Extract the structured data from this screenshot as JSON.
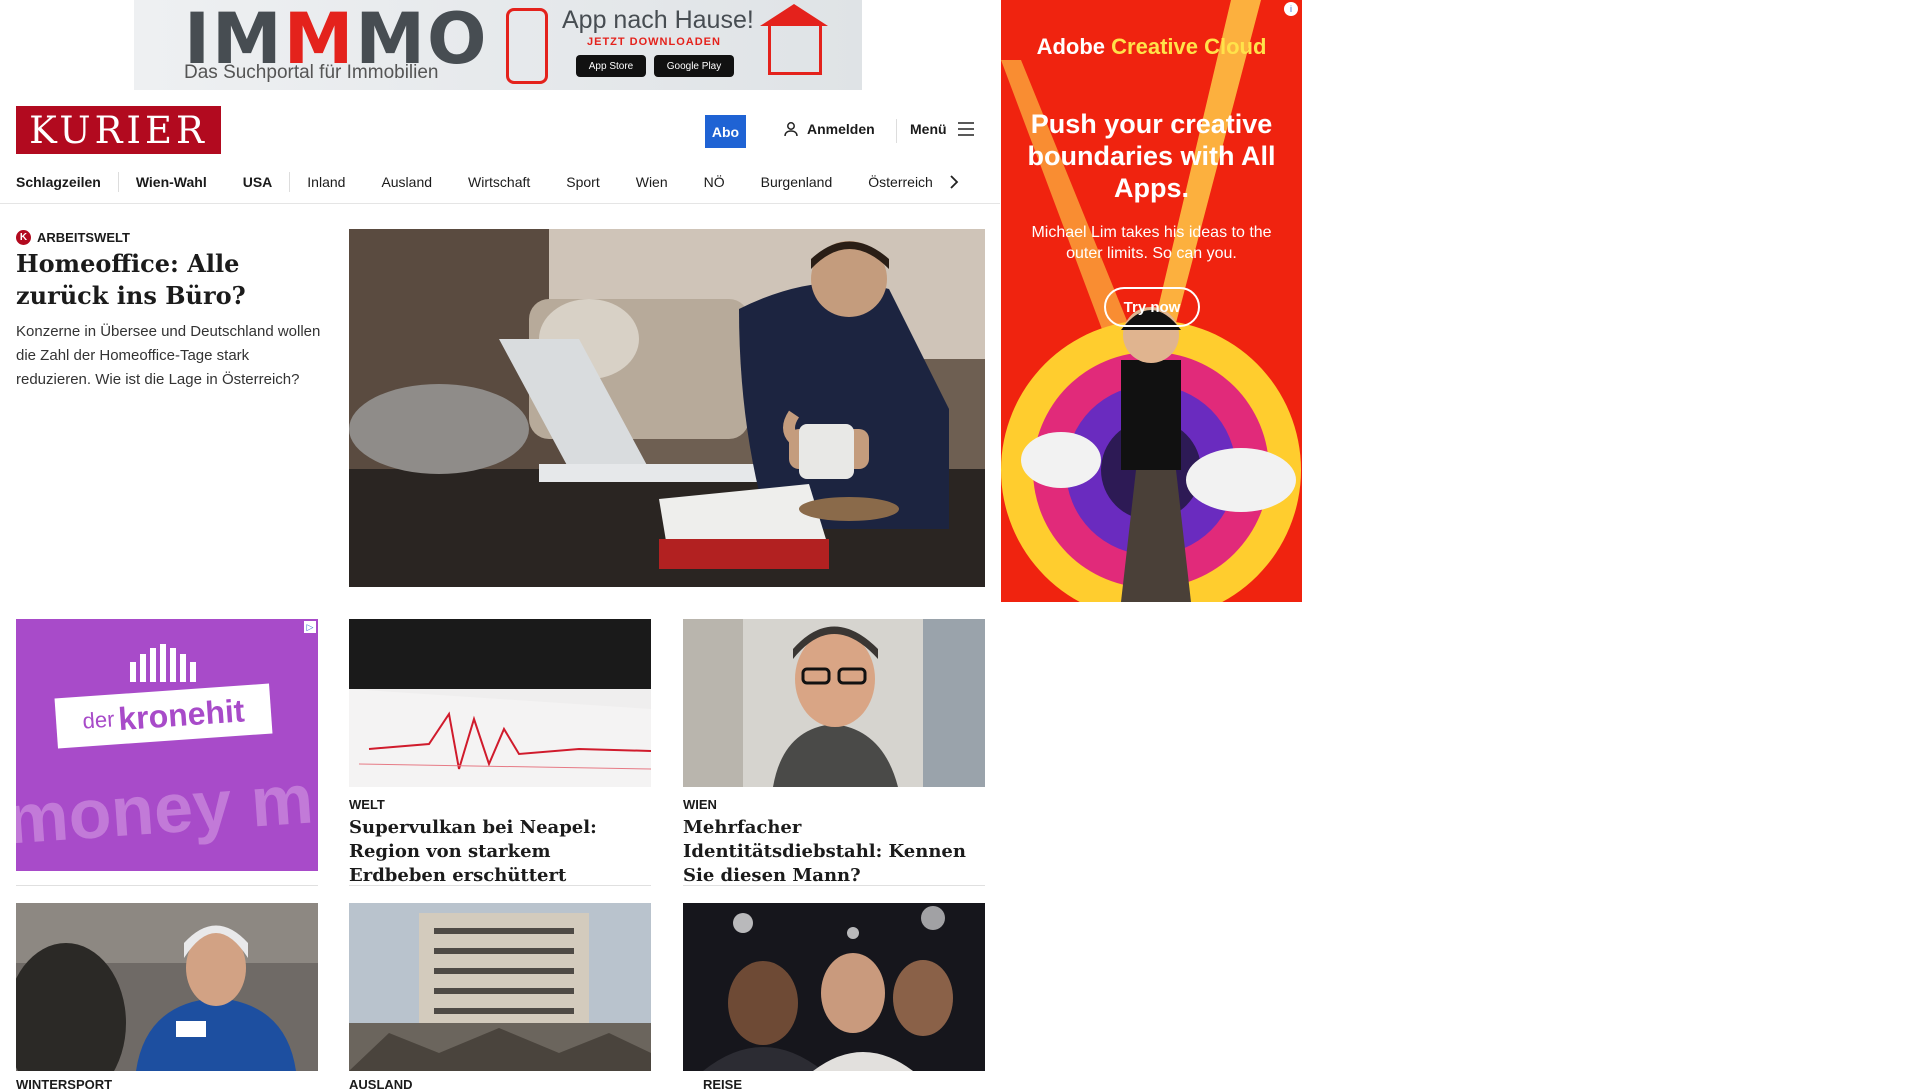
{
  "top_ad": {
    "logo_part1": "IM",
    "logo_part2": "M",
    "logo_part3": "MO",
    "subtitle": "Das Suchportal für Immobilien",
    "app_title": "App nach Hause!",
    "cta": "JETZT DOWNLOADEN",
    "app_store": "App Store",
    "google_play": "Google Play"
  },
  "header": {
    "logo": "KURIER",
    "abo": "Abo",
    "login": "Anmelden",
    "menu": "Menü"
  },
  "nav": {
    "items": [
      "Schlagzeilen",
      "Wien-Wahl",
      "USA",
      "Inland",
      "Ausland",
      "Wirtschaft",
      "Sport",
      "Wien",
      "NÖ",
      "Burgenland",
      "Österreich"
    ]
  },
  "hero": {
    "kicker": "ARBEITSWELT",
    "title": "Homeoffice: Alle zurück ins Büro?",
    "teaser": "Konzerne in Übersee und Deutschland wollen die Zahl der Homeoffice-Tage stark reduzieren. Wie ist die Lage in Österreich?"
  },
  "side_ad": {
    "brand1": "Adobe",
    "brand2": "Creative Cloud",
    "headline": "Push your creative boundaries with All Apps.",
    "sub": "Michael Lim takes his ideas to the outer limits. So can you.",
    "button": "Try now"
  },
  "kronehit_ad": {
    "pre": "der",
    "brand": "kronehit",
    "bg_text": "money m"
  },
  "cards": [
    {
      "kicker": "WELT",
      "title": "Supervulkan bei Neapel: Region von starkem Erdbeben erschüttert"
    },
    {
      "kicker": "WIEN",
      "title": "Mehrfacher Identitätsdiebstahl: Kennen Sie diesen Mann?"
    }
  ],
  "row3": [
    {
      "kicker": "WINTERSPORT"
    },
    {
      "kicker": "AUSLAND"
    },
    {
      "kicker": "REISE"
    }
  ],
  "colors": {
    "kurier_red": "#b20a1f",
    "abo_blue": "#1f63d4",
    "adobe_red": "#f0230f",
    "kronehit_purple": "#a84bc9"
  }
}
